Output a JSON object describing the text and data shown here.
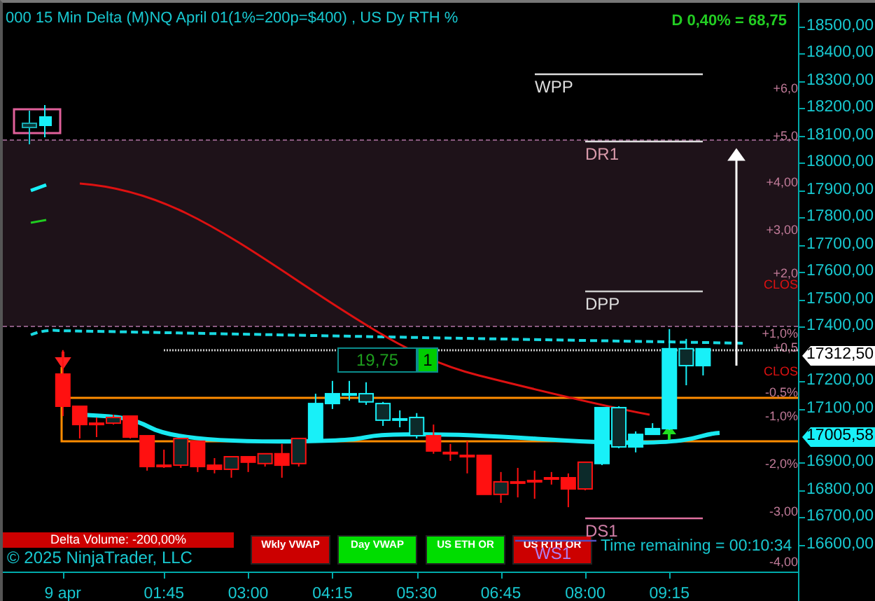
{
  "chart_title": "000 15 Min Delta (M)NQ  April 01(1%=200p=$400) , US Dy RTH %",
  "delta_readout": "D 0,40% = 68,75",
  "pivot_levels": [
    {
      "label": "WPP",
      "kind": "weekly"
    },
    {
      "label": "DR1",
      "kind": "resistance"
    },
    {
      "label": "DPP",
      "kind": "pivot"
    },
    {
      "label": "DS1",
      "kind": "support"
    },
    {
      "label": "WS1",
      "kind": "weekly_support"
    }
  ],
  "percent_labels": [
    {
      "text": "+6,0",
      "kind": "percent"
    },
    {
      "text": "+5,0",
      "kind": "percent"
    },
    {
      "text": "+4,00",
      "kind": "percent"
    },
    {
      "text": "+3,00",
      "kind": "percent"
    },
    {
      "text": "+2,0",
      "kind": "percent"
    },
    {
      "text": "CLOS",
      "kind": "close"
    },
    {
      "text": "+1,0%",
      "kind": "percent"
    },
    {
      "text": "+0,5",
      "kind": "percent"
    },
    {
      "text": "CLOS",
      "kind": "close"
    },
    {
      "text": "-0,5%",
      "kind": "percent"
    },
    {
      "text": "-1,0%",
      "kind": "percent"
    },
    {
      "text": "-2,0%",
      "kind": "percent"
    },
    {
      "text": "-3,00",
      "kind": "percent"
    },
    {
      "text": "-4,00",
      "kind": "percent"
    }
  ],
  "order_tag": {
    "value": "19,75",
    "quantity": "1"
  },
  "chart": {
    "chart_data": {
      "type": "candlestick",
      "x": [
        0.25,
        0.5,
        0.75,
        1,
        1.25,
        1.5,
        1.75,
        2,
        2.25,
        2.5,
        2.75,
        3,
        3.25,
        3.5,
        3.75,
        4,
        4.25,
        4.5,
        4.75,
        5,
        5.25,
        5.5,
        5.75,
        6,
        6.25,
        6.5,
        6.75,
        7,
        7.25,
        7.5,
        7.75,
        8,
        8.25,
        8.5,
        8.75,
        9,
        9.25,
        9.5,
        9.75
      ],
      "xlim": [
        -0.6,
        11.2
      ],
      "ylim": [
        16502,
        18587
      ],
      "series": [
        {
          "color": "#ff1010",
          "ohlc": [
            [
              17226,
              17314,
              17072,
              17108
            ],
            [
              17108,
              17108,
              16990,
              17041
            ],
            [
              17046,
              17067,
              16995,
              17041
            ],
            [
              17046,
              17077,
              17041,
              17067
            ],
            [
              17072,
              17072,
              16990,
              16995
            ],
            [
              17000,
              17000,
              16872,
              16887
            ],
            [
              16892,
              16949,
              16882,
              16887
            ],
            [
              16892,
              16990,
              16882,
              16990
            ],
            [
              16980,
              16980,
              16867,
              16887
            ],
            [
              16892,
              16918,
              16862,
              16877
            ],
            [
              16877,
              16923,
              16846,
              16923
            ],
            [
              16923,
              16923,
              16867,
              16903
            ],
            [
              16898,
              16934,
              16887,
              16934
            ],
            [
              16934,
              16970,
              16846,
              16892
            ],
            [
              16898,
              16990,
              16887,
              16990
            ],
            null,
            null,
            null,
            null,
            null,
            null,
            null,
            [
              17000,
              17041,
              16934,
              16944
            ],
            [
              16939,
              16970,
              16908,
              16934
            ],
            [
              16928,
              16980,
              16862,
              16923
            ],
            [
              16928,
              16928,
              16785,
              16785
            ],
            [
              16785,
              16867,
              16754,
              16831
            ],
            [
              16831,
              16882,
              16774,
              16826
            ],
            [
              16836,
              16872,
              16769,
              16831
            ],
            [
              16846,
              16867,
              16821,
              16841
            ],
            [
              16846,
              16862,
              16738,
              16805
            ],
            [
              16805,
              16903,
              16800,
              16903
            ],
            null,
            null,
            null,
            null,
            null,
            null,
            null
          ]
        },
        {
          "color": "#18f0f8",
          "ohlc": [
            null,
            null,
            null,
            null,
            null,
            null,
            null,
            null,
            null,
            null,
            null,
            null,
            null,
            null,
            null,
            [
              17118,
              17154,
              16975,
              16980
            ],
            [
              17154,
              17201,
              17098,
              17118
            ],
            [
              17154,
              17201,
              17129,
              17149
            ],
            [
              17124,
              17196,
              17113,
              17154
            ],
            [
              17057,
              17124,
              17036,
              17118
            ],
            [
              17062,
              17093,
              17031,
              17057
            ],
            [
              17000,
              17083,
              16990,
              17067
            ],
            null,
            null,
            null,
            null,
            null,
            null,
            null,
            null,
            null,
            null,
            [
              17103,
              17103,
              16892,
              16898
            ],
            [
              16959,
              17108,
              16954,
              17103
            ],
            [
              17005,
              17016,
              16939,
              16959
            ],
            [
              17026,
              17046,
              17005,
              17005
            ],
            [
              17319,
              17391,
              17021,
              17026
            ],
            [
              17257,
              17355,
              17185,
              17319
            ],
            [
              17319,
              17319,
              17221,
              17257
            ]
          ]
        }
      ],
      "xticks": [
        {
          "value": 0.25,
          "label": "9 apr"
        },
        {
          "value": 1.75,
          "label": "01:45"
        },
        {
          "value": 3,
          "label": "03:00"
        },
        {
          "value": 4.25,
          "label": "04:15"
        },
        {
          "value": 5.5,
          "label": "05:30"
        },
        {
          "value": 6.75,
          "label": "06:45"
        },
        {
          "value": 8,
          "label": "08:00"
        },
        {
          "value": 9.25,
          "label": "09:15"
        }
      ],
      "yticks": [
        {
          "value": 18500,
          "label": "18500,00"
        },
        {
          "value": 18400,
          "label": "18400,00"
        },
        {
          "value": 18300,
          "label": "18300,00"
        },
        {
          "value": 18200,
          "label": "18200,00"
        },
        {
          "value": 18100,
          "label": "18100,00"
        },
        {
          "value": 18000,
          "label": "18000,00"
        },
        {
          "value": 17900,
          "label": "17900,00"
        },
        {
          "value": 17800,
          "label": "17800,00"
        },
        {
          "value": 17700,
          "label": "17700,00"
        },
        {
          "value": 17600,
          "label": "17600,00"
        },
        {
          "value": 17500,
          "label": "17500,00"
        },
        {
          "value": 17400,
          "label": "17400,00"
        },
        {
          "value": 17200,
          "label": "17200,00"
        },
        {
          "value": 17100,
          "label": "17100,00"
        },
        {
          "value": 16900,
          "label": "16900,00"
        },
        {
          "value": 16800,
          "label": "16800,00"
        },
        {
          "value": 16700,
          "label": "16700,00"
        },
        {
          "value": 16600,
          "label": "16600,00"
        }
      ]
    },
    "markers": [
      {
        "text": "17312,50",
        "kind": "last"
      },
      {
        "text": "17005,58",
        "kind": "vwap"
      }
    ]
  },
  "delta_volume": "Delta Volume: -200,00%",
  "copyright": "© 2025 NinjaTrader, LLC",
  "toggles": [
    {
      "label": "Wkly VWAP",
      "color": "#cc0000"
    },
    {
      "label": "Day VWAP",
      "color": "#00dd00"
    },
    {
      "label": "US ETH OR",
      "color": "#00dd00"
    },
    {
      "label": "US RTH OR",
      "color": "#cc0000"
    }
  ],
  "time_remaining": "Time remaining = 00:10:34"
}
